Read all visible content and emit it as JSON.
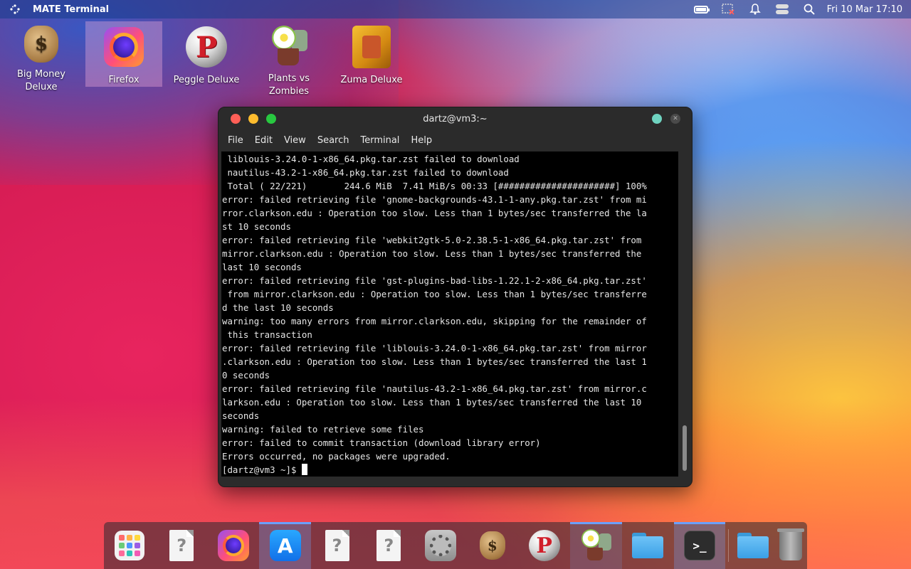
{
  "topbar": {
    "app_title": "MATE Terminal",
    "clock": "Fri 10 Mar 17:10",
    "icons": [
      "menu-icon",
      "battery-icon",
      "network-icon",
      "notification-bell-icon",
      "toggles-icon",
      "search-icon"
    ]
  },
  "desktop": {
    "icons": [
      {
        "label": "Big Money\nDeluxe",
        "icon": "money-bag-icon"
      },
      {
        "label": "Firefox",
        "icon": "firefox-icon"
      },
      {
        "label": "Peggle Deluxe",
        "icon": "peggle-icon"
      },
      {
        "label": "Plants vs\nZombies",
        "icon": "plants-vs-zombies-icon"
      },
      {
        "label": "Zuma Deluxe",
        "icon": "zuma-icon"
      }
    ]
  },
  "terminal": {
    "title": "dartz@vm3:~",
    "menu": [
      "File",
      "Edit",
      "View",
      "Search",
      "Terminal",
      "Help"
    ],
    "lines": [
      " liblouis-3.24.0-1-x86_64.pkg.tar.zst failed to download",
      " nautilus-43.2-1-x86_64.pkg.tar.zst failed to download",
      " Total ( 22/221)       244.6 MiB  7.41 MiB/s 00:33 [######################] 100%",
      "error: failed retrieving file 'gnome-backgrounds-43.1-1-any.pkg.tar.zst' from mi",
      "rror.clarkson.edu : Operation too slow. Less than 1 bytes/sec transferred the la",
      "st 10 seconds",
      "error: failed retrieving file 'webkit2gtk-5.0-2.38.5-1-x86_64.pkg.tar.zst' from",
      "mirror.clarkson.edu : Operation too slow. Less than 1 bytes/sec transferred the",
      "last 10 seconds",
      "error: failed retrieving file 'gst-plugins-bad-libs-1.22.1-2-x86_64.pkg.tar.zst'",
      " from mirror.clarkson.edu : Operation too slow. Less than 1 bytes/sec transferre",
      "d the last 10 seconds",
      "warning: too many errors from mirror.clarkson.edu, skipping for the remainder of",
      " this transaction",
      "error: failed retrieving file 'liblouis-3.24.0-1-x86_64.pkg.tar.zst' from mirror",
      ".clarkson.edu : Operation too slow. Less than 1 bytes/sec transferred the last 1",
      "0 seconds",
      "error: failed retrieving file 'nautilus-43.2-1-x86_64.pkg.tar.zst' from mirror.c",
      "larkson.edu : Operation too slow. Less than 1 bytes/sec transferred the last 10",
      "seconds",
      "warning: failed to retrieve some files",
      "error: failed to commit transaction (download library error)",
      "Errors occurred, no packages were upgraded."
    ],
    "prompt": "[dartz@vm3 ~]$ "
  },
  "dock": {
    "items": [
      {
        "name": "app-launcher",
        "icon": "app-grid-icon"
      },
      {
        "name": "unknown-app-1",
        "icon": "document-icon",
        "glyph": "?"
      },
      {
        "name": "firefox",
        "icon": "firefox-icon"
      },
      {
        "name": "app-store",
        "icon": "app-store-icon",
        "glyph": "A"
      },
      {
        "name": "unknown-app-2",
        "icon": "document-icon",
        "glyph": "?"
      },
      {
        "name": "unknown-app-3",
        "icon": "document-icon",
        "glyph": "?"
      },
      {
        "name": "settings",
        "icon": "settings-icon"
      },
      {
        "name": "big-money-deluxe",
        "icon": "money-bag-icon",
        "glyph": "$"
      },
      {
        "name": "peggle-deluxe",
        "icon": "peggle-icon",
        "glyph": "P"
      },
      {
        "name": "plants-vs-zombies",
        "icon": "plants-vs-zombies-icon"
      },
      {
        "name": "files",
        "icon": "folder-icon"
      },
      {
        "name": "mate-terminal",
        "icon": "terminal-icon",
        "glyph": ">_"
      },
      {
        "name": "home-folder",
        "icon": "folder-icon"
      },
      {
        "name": "trash",
        "icon": "trash-icon"
      }
    ]
  },
  "desktop_glyphs": {
    "money": "$",
    "peggle": "P"
  },
  "colors": {
    "close": "#ff5f57",
    "minimize": "#febc2e",
    "maximize": "#28c840",
    "accent": "#6aa0ff"
  }
}
